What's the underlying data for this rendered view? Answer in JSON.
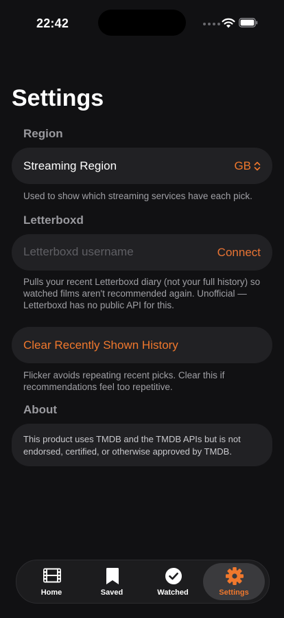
{
  "status_bar": {
    "time": "22:42",
    "icons": [
      "signal-dots-icon",
      "wifi-icon",
      "battery-icon"
    ]
  },
  "page": {
    "title": "Settings"
  },
  "region": {
    "header": "Region",
    "row_label": "Streaming Region",
    "row_value": "GB",
    "footnote": "Used to show which streaming services have each pick."
  },
  "letterboxd": {
    "header": "Letterboxd",
    "placeholder": "Letterboxd username",
    "value": "",
    "connect_label": "Connect",
    "footnote": "Pulls your recent Letterboxd diary (not your full history) so watched films aren't recommended again. Unofficial — Letterboxd has no public API for this."
  },
  "history": {
    "clear_label": "Clear Recently Shown History",
    "footnote": "Flicker avoids repeating recent picks. Clear this if recommendations feel too repetitive."
  },
  "about": {
    "header": "About",
    "text": "This product uses TMDB and the TMDB APIs but is not endorsed, certified, or otherwise approved by TMDB."
  },
  "tabs": [
    {
      "label": "Home",
      "icon": "film-icon",
      "active": false
    },
    {
      "label": "Saved",
      "icon": "bookmark-icon",
      "active": false
    },
    {
      "label": "Watched",
      "icon": "checkmark-circle-icon",
      "active": false
    },
    {
      "label": "Settings",
      "icon": "gear-icon",
      "active": true
    }
  ],
  "colors": {
    "accent": "#f0782d",
    "background": "#111113",
    "card": "#212124",
    "secondary_text": "#9a9a9f"
  }
}
